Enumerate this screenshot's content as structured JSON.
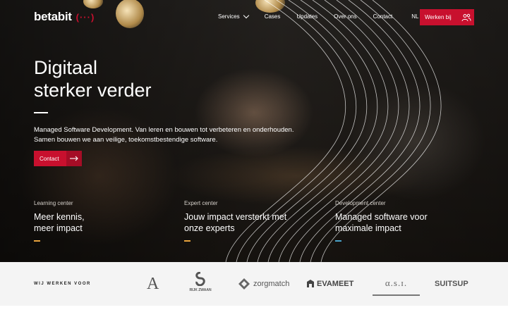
{
  "brand": {
    "name": "betabit",
    "mark": "(···)"
  },
  "nav": {
    "items": [
      {
        "label": "Services",
        "dropdown": true
      },
      {
        "label": "Cases",
        "dropdown": false
      },
      {
        "label": "Updates",
        "dropdown": false
      },
      {
        "label": "Over ons",
        "dropdown": false
      },
      {
        "label": "Contact",
        "dropdown": false
      }
    ],
    "language": "NL",
    "cta_label": "Werken bij"
  },
  "hero": {
    "title_line1": "Digitaal",
    "title_line2": "sterker verder",
    "intro_line1": "Managed Software Development. Van leren en bouwen tot verbeteren en onderhouden.",
    "intro_line2": "Samen bouwen we aan veilige, toekomstbestendige software.",
    "button_label": "Contact"
  },
  "centers": [
    {
      "kicker": "Learning center",
      "title_line1": "Meer kennis,",
      "title_line2": "meer impact",
      "accent": "#e8a33d"
    },
    {
      "kicker": "Expert center",
      "title_line1": "Jouw impact versterkt met",
      "title_line2": "onze experts",
      "accent": "#e8a33d"
    },
    {
      "kicker": "Development center",
      "title_line1": "Managed software voor",
      "title_line2": "maximale impact",
      "accent": "#4aa3c9"
    }
  ],
  "clients": {
    "label": "WIJ WERKEN VOOR",
    "logos": [
      {
        "name": "A",
        "icon": "a-serif-logo"
      },
      {
        "name": "RIJK ZWAAN",
        "icon": "rijk-zwaan-logo"
      },
      {
        "name": "zorgmatch",
        "icon": "zorgmatch-logo"
      },
      {
        "name": "EVAMEET",
        "icon": "evameet-logo"
      },
      {
        "name": "α.s.ɪ.",
        "icon": "asi-logo"
      },
      {
        "name": "SUITSUP",
        "icon": "suitsup-logo"
      }
    ]
  },
  "colors": {
    "accent_red": "#c8102e",
    "nav_text": "#ffffff",
    "clients_bg": "#f4f4f4"
  }
}
